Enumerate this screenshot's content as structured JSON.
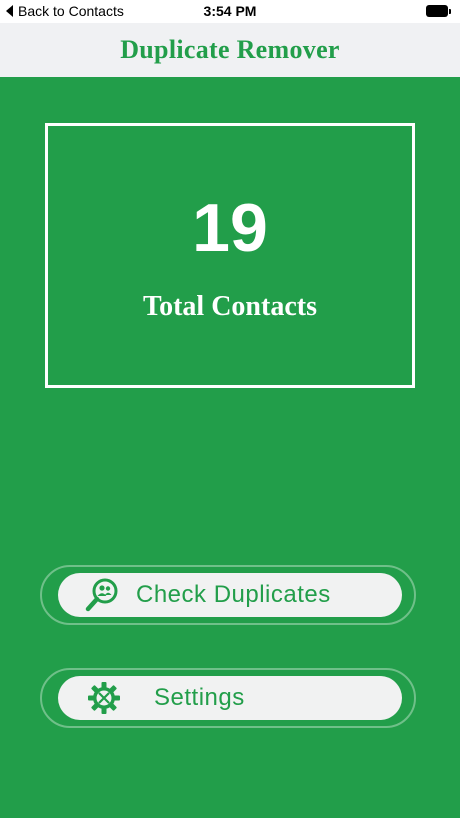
{
  "status_bar": {
    "back_label": "Back to Contacts",
    "time": "3:54 PM"
  },
  "nav": {
    "title": "Duplicate Remover"
  },
  "summary": {
    "count": "19",
    "label": "Total Contacts"
  },
  "buttons": {
    "check_duplicates": "Check Duplicates",
    "settings": "Settings"
  },
  "colors": {
    "accent": "#229e4a",
    "button_bg": "#f1f2f2",
    "nav_bg": "#f0f1f3"
  },
  "icons": {
    "check_duplicates": "search-people-icon",
    "settings": "gear-tools-icon"
  }
}
